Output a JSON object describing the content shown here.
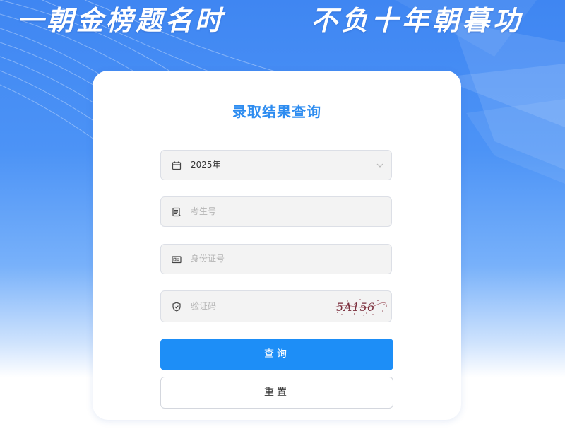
{
  "banner": {
    "slogan_left": "一朝金榜题名时",
    "slogan_right": "不负十年朝暮功"
  },
  "form": {
    "title": "录取结果查询",
    "year": {
      "icon": "calendar-icon",
      "value": "2025年"
    },
    "exam_number": {
      "icon": "id-badge-icon",
      "placeholder": "考生号"
    },
    "id_card": {
      "icon": "id-card-icon",
      "placeholder": "身份证号"
    },
    "captcha": {
      "icon": "shield-check-icon",
      "placeholder": "验证码",
      "image_text": "5A156"
    },
    "query_button": "查询",
    "reset_button": "重置"
  },
  "colors": {
    "accent": "#2d8cf0",
    "primary_button": "#1d8ef7",
    "input_bg": "#f3f3f3",
    "background_top": "#3f86f2"
  }
}
